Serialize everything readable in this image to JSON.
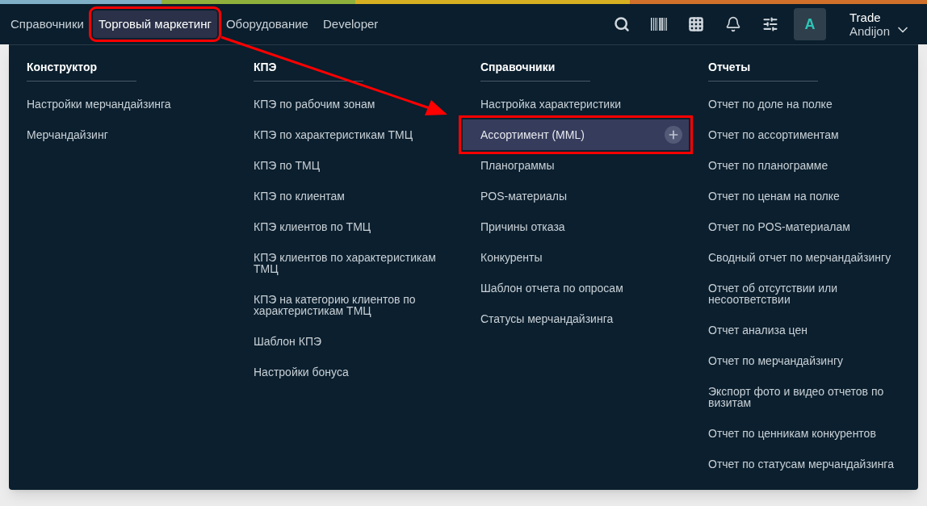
{
  "nav": {
    "tabs": [
      {
        "label": "Справочники",
        "selected": false
      },
      {
        "label": "Торговый маркетинг",
        "selected": true
      },
      {
        "label": "Оборудование",
        "selected": false
      },
      {
        "label": "Developer",
        "selected": false
      }
    ]
  },
  "user": {
    "initial": "A",
    "name": "Trade",
    "region": "Andijon"
  },
  "menu": {
    "columns": [
      {
        "heading": "Конструктор",
        "items": [
          {
            "label": "Настройки мерчандайзинга",
            "selected": false
          },
          {
            "label": "Мерчандайзинг",
            "selected": false
          }
        ]
      },
      {
        "heading": "КПЭ",
        "items": [
          {
            "label": "КПЭ по рабочим зонам",
            "selected": false
          },
          {
            "label": "КПЭ по характеристикам ТМЦ",
            "selected": false
          },
          {
            "label": "КПЭ по ТМЦ",
            "selected": false
          },
          {
            "label": "КПЭ по клиентам",
            "selected": false
          },
          {
            "label": "КПЭ клиентов по ТМЦ",
            "selected": false
          },
          {
            "label": "КПЭ клиентов по характеристикам ТМЦ",
            "selected": false
          },
          {
            "label": "КПЭ на категорию клиентов по характеристикам ТМЦ",
            "selected": false
          },
          {
            "label": "Шаблон КПЭ",
            "selected": false
          },
          {
            "label": "Настройки бонуса",
            "selected": false
          }
        ]
      },
      {
        "heading": "Справочники",
        "items": [
          {
            "label": "Настройка характеристики",
            "selected": false
          },
          {
            "label": "Ассортимент (MML)",
            "selected": true
          },
          {
            "label": "Планограммы",
            "selected": false
          },
          {
            "label": "POS-материалы",
            "selected": false
          },
          {
            "label": "Причины отказа",
            "selected": false
          },
          {
            "label": "Конкуренты",
            "selected": false
          },
          {
            "label": "Шаблон отчета по опросам",
            "selected": false
          },
          {
            "label": "Статусы мерчандайзинга",
            "selected": false
          }
        ]
      },
      {
        "heading": "Отчеты",
        "items": [
          {
            "label": "Отчет по доле на полке",
            "selected": false
          },
          {
            "label": "Отчет по ассортиментам",
            "selected": false
          },
          {
            "label": "Отчет по планограмме",
            "selected": false
          },
          {
            "label": "Отчет по ценам на полке",
            "selected": false
          },
          {
            "label": "Отчет по POS-материалам",
            "selected": false
          },
          {
            "label": "Сводный отчет по мерчандайзингу",
            "selected": false
          },
          {
            "label": "Отчет об отсутствии или несоответствии",
            "selected": false
          },
          {
            "label": "Отчет анализа цен",
            "selected": false
          },
          {
            "label": "Отчет по мерчандайзингу",
            "selected": false
          },
          {
            "label": "Экспорт фото и видео отчетов по визитам",
            "selected": false
          },
          {
            "label": "Отчет по ценникам конкурентов",
            "selected": false
          },
          {
            "label": "Отчет по статусам мерчандайзинга",
            "selected": false
          }
        ]
      }
    ]
  }
}
